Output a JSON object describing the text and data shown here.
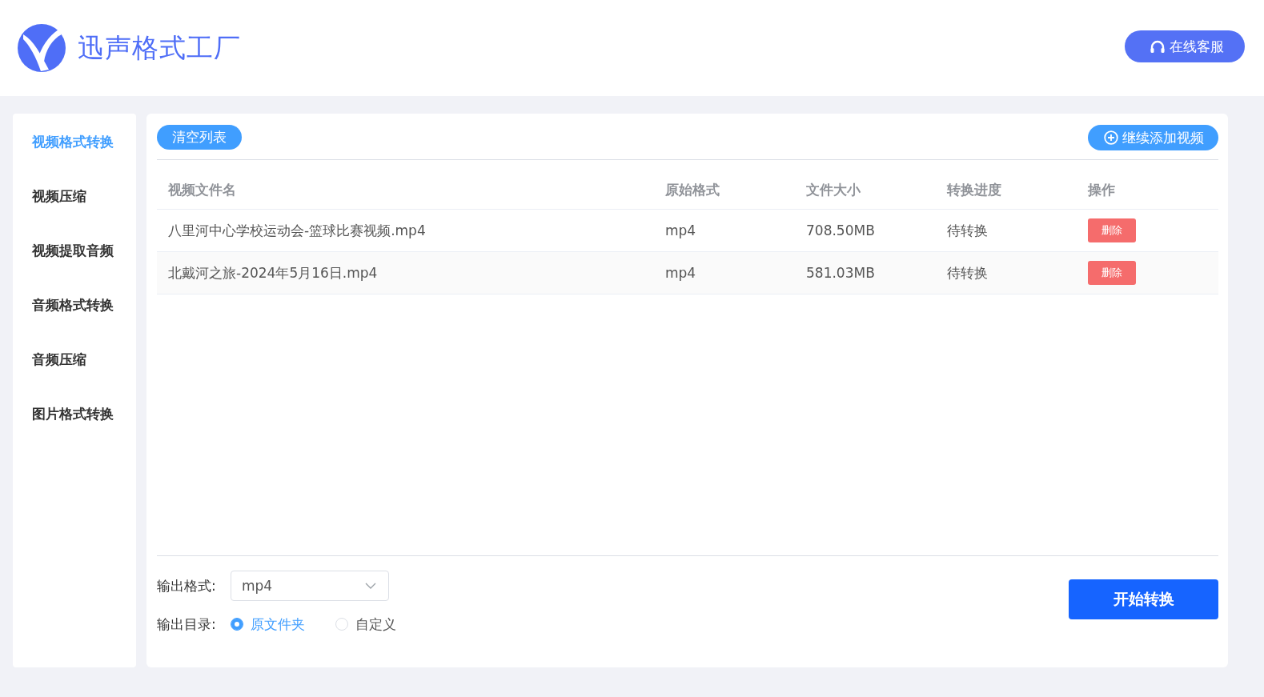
{
  "header": {
    "app_name": "迅声格式工厂",
    "support_button": "在线客服"
  },
  "sidebar": {
    "items": [
      {
        "label": "视频格式转换",
        "selected": true
      },
      {
        "label": "视频压缩",
        "selected": false
      },
      {
        "label": "视频提取音频",
        "selected": false
      },
      {
        "label": "音频格式转换",
        "selected": false
      },
      {
        "label": "音频压缩",
        "selected": false
      },
      {
        "label": "图片格式转换",
        "selected": false
      }
    ]
  },
  "toolbar": {
    "clear_button": "清空列表",
    "add_button": "继续添加视频"
  },
  "table": {
    "columns": [
      "视频文件名",
      "原始格式",
      "文件大小",
      "转换进度",
      "操作"
    ],
    "rows": [
      {
        "name": "八里河中心学校运动会-篮球比赛视频.mp4",
        "format": "mp4",
        "size": "708.50MB",
        "progress": "待转换",
        "action": "删除"
      },
      {
        "name": "北戴河之旅-2024年5月16日.mp4",
        "format": "mp4",
        "size": "581.03MB",
        "progress": "待转换",
        "action": "删除"
      }
    ]
  },
  "output": {
    "format_label": "输出格式:",
    "format_value": "mp4",
    "dir_label": "输出目录:",
    "dir_options": [
      {
        "label": "原文件夹",
        "selected": true
      },
      {
        "label": "自定义",
        "selected": false
      }
    ],
    "start_button": "开始转换"
  }
}
